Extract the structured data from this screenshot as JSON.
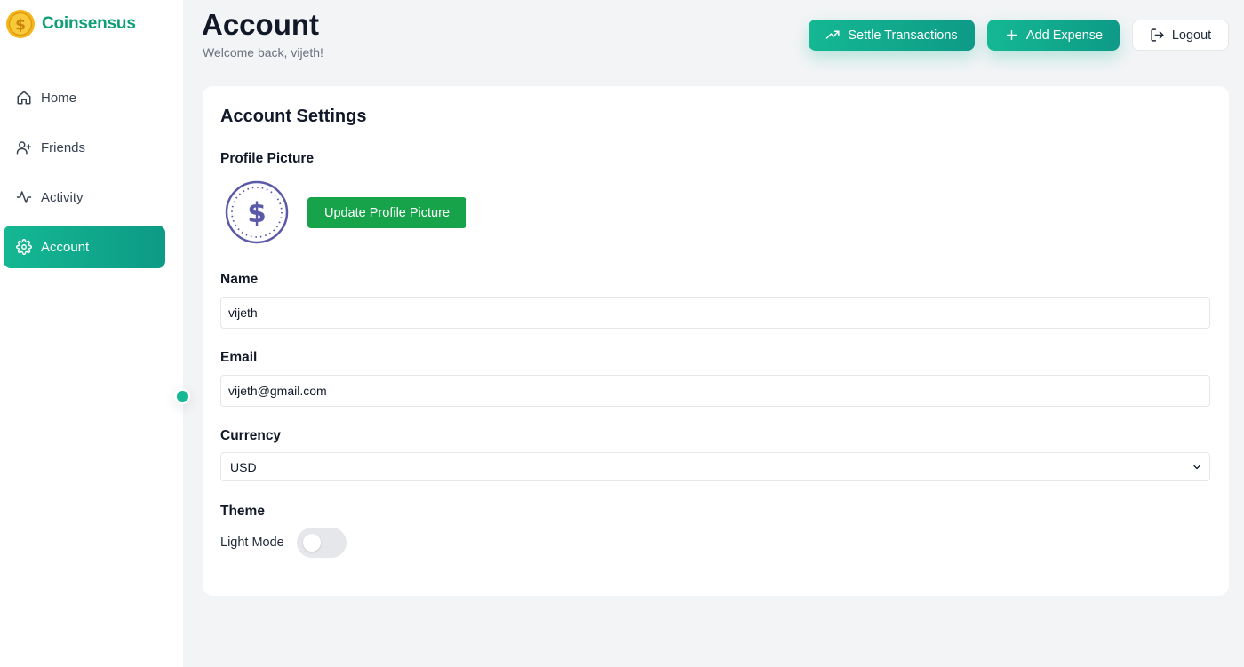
{
  "brand": {
    "name": "Coinsensus",
    "accent": "#0f9f77"
  },
  "sidebar": {
    "items": [
      {
        "label": "Home",
        "icon": "home-icon",
        "active": false
      },
      {
        "label": "Friends",
        "icon": "user-plus-icon",
        "active": false
      },
      {
        "label": "Activity",
        "icon": "activity-icon",
        "active": false
      },
      {
        "label": "Account",
        "icon": "gear-icon",
        "active": true
      }
    ]
  },
  "header": {
    "title": "Account",
    "subtitle": "Welcome back, vijeth!",
    "settle_label": "Settle Transactions",
    "add_label": "Add Expense",
    "logout_label": "Logout"
  },
  "settings": {
    "title": "Account Settings",
    "profile_picture_label": "Profile Picture",
    "update_picture_label": "Update Profile Picture",
    "name_label": "Name",
    "name_value": "vijeth",
    "email_label": "Email",
    "email_value": "vijeth@gmail.com",
    "currency_label": "Currency",
    "currency_value": "USD",
    "theme_label": "Theme",
    "theme_mode": "Light Mode",
    "dark_mode_enabled": false
  },
  "colors": {
    "primary_green": "#14b893",
    "update_button": "#16a34a",
    "avatar_purple": "#5b5aa8"
  }
}
